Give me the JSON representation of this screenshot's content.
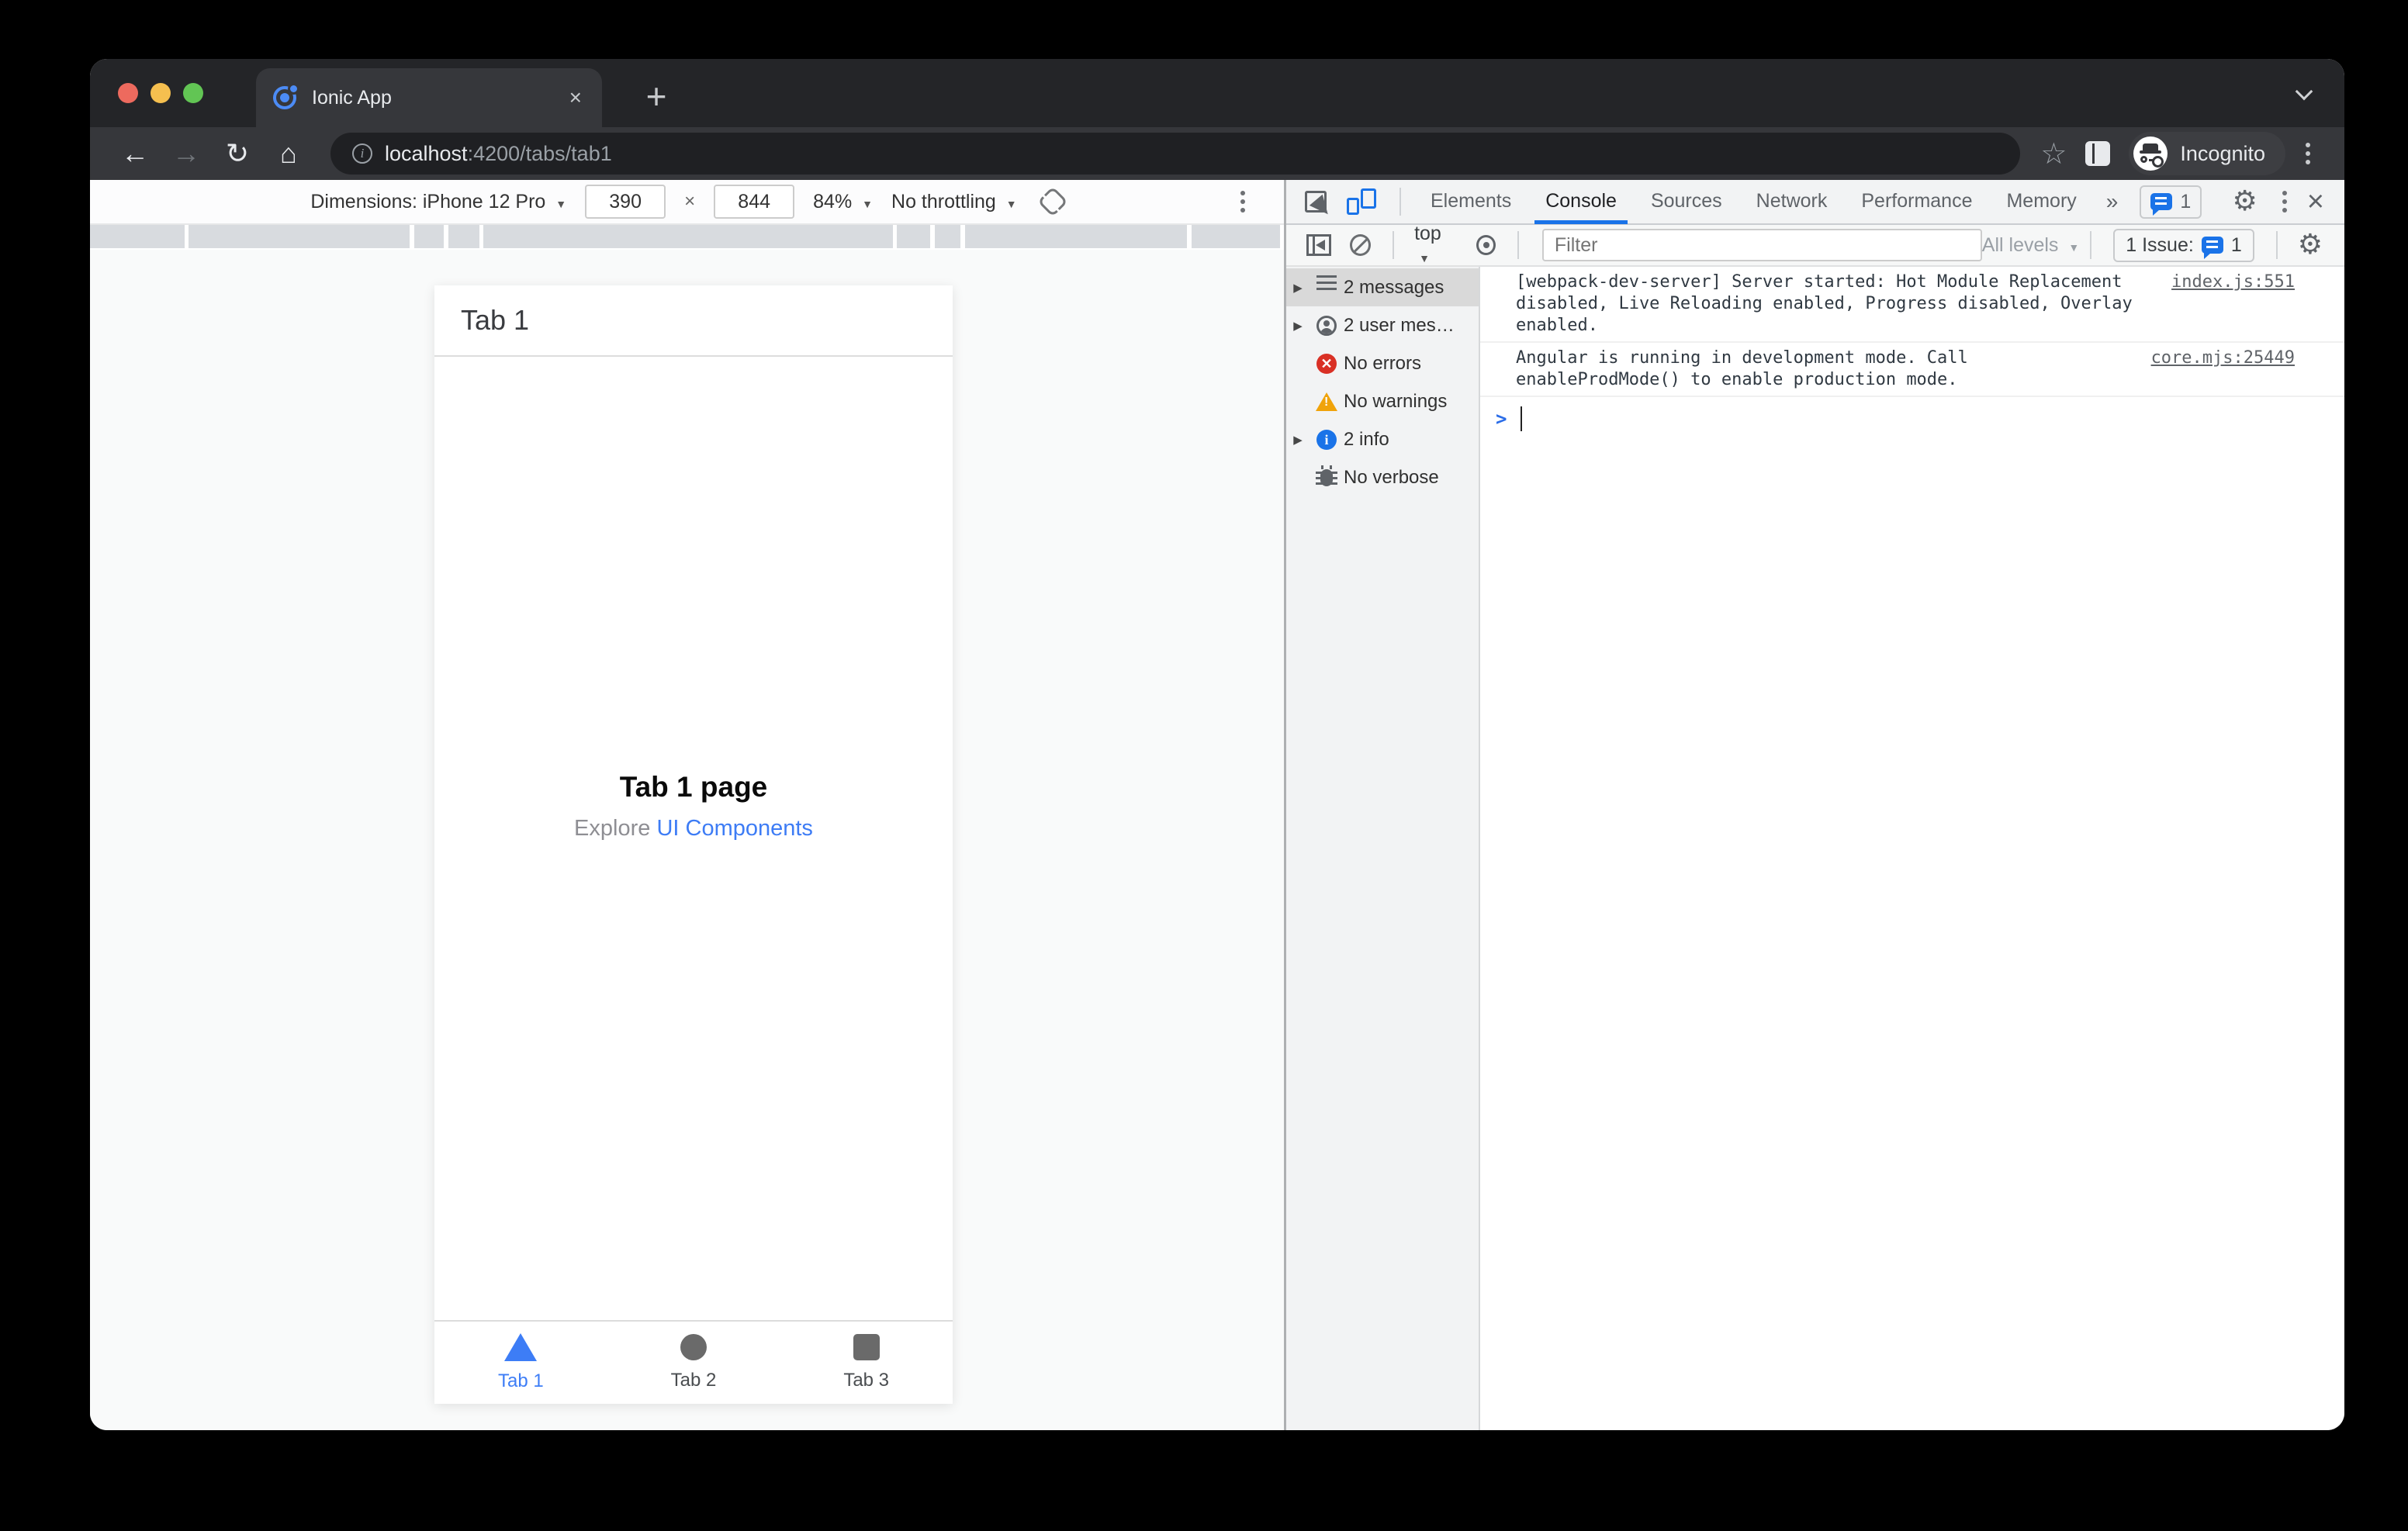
{
  "browser_tab": {
    "title": "Ionic App",
    "close": "×"
  },
  "address_bar": {
    "back": "←",
    "forward": "→",
    "reload": "↻",
    "home": "⌂",
    "star": "☆",
    "info": "i",
    "host": "localhost",
    "path": ":4200/tabs/tab1",
    "incognito_label": "Incognito"
  },
  "device_toolbar": {
    "dimensions_label": "Dimensions: iPhone 12 Pro",
    "width_value": "390",
    "separator": "×",
    "height_value": "844",
    "zoom_value": "84%",
    "throttling_value": "No throttling",
    "caret": "▼"
  },
  "devtools": {
    "tabs": [
      {
        "label": "Elements"
      },
      {
        "label": "Console"
      },
      {
        "label": "Sources"
      },
      {
        "label": "Network"
      },
      {
        "label": "Performance"
      },
      {
        "label": "Memory"
      }
    ],
    "more_tabs": "»",
    "tabbar_issue_count": "1",
    "gear": "⚙",
    "close": "×",
    "console_toolbar": {
      "context": "top",
      "caret": "▼",
      "filter_placeholder": "Filter",
      "levels": "All levels",
      "issue_text": "1 Issue:",
      "issue_count": "1"
    },
    "sidebar": {
      "items": [
        {
          "label": "2 messages"
        },
        {
          "label": "2 user mes…"
        },
        {
          "label": "No errors"
        },
        {
          "label": "No warnings"
        },
        {
          "label": "2 info"
        },
        {
          "label": "No verbose"
        }
      ],
      "expand_arrow": "▶"
    },
    "console": {
      "messages": [
        {
          "text": "[webpack-dev-server] Server started: Hot Module Replacement disabled, Live Reloading enabled, Progress disabled, Overlay enabled.",
          "source": "index.js:551"
        },
        {
          "text": "Angular is running in development mode. Call enableProdMode() to enable production mode.",
          "source": "core.mjs:25449"
        }
      ],
      "prompt": ">"
    }
  },
  "app": {
    "header_title": "Tab 1",
    "page_title": "Tab 1 page",
    "explore_text": "Explore ",
    "explore_link": "UI Components",
    "tabs": [
      {
        "label": "Tab 1"
      },
      {
        "label": "Tab 2"
      },
      {
        "label": "Tab 3"
      }
    ]
  },
  "colors": {
    "accent_blue": "#1a73e8",
    "ionic_blue": "#3d7df6",
    "error_red": "#d93025",
    "warning_amber": "#f0a30a",
    "frame_dark": "#242528",
    "toolbar_dark": "#36373b"
  }
}
